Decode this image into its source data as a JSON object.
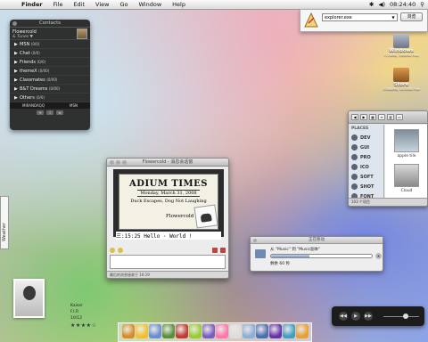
{
  "menubar": {
    "app": "Finder",
    "menus": [
      "File",
      "Edit",
      "View",
      "Go",
      "Window",
      "Help"
    ],
    "clock": "08:24:40"
  },
  "contacts": {
    "title": "Contacts",
    "me_nick": "Flowercold",
    "me_status": "& Tunes ▼",
    "groups": [
      {
        "name": "MSN",
        "count": "(0/0)"
      },
      {
        "name": "Chat",
        "count": "(0/0)"
      },
      {
        "name": "Friends",
        "count": "(0/0)"
      },
      {
        "name": "themeX",
        "count": "(0/00)"
      },
      {
        "name": "Classmates",
        "count": "(0/00)"
      },
      {
        "name": "B&T Dreams",
        "count": "(0/00)"
      },
      {
        "name": "Others",
        "count": "(0/0)"
      }
    ],
    "account_left": "MIRANDAQQ",
    "account_right": "MSN"
  },
  "weather": {
    "label": "Weather"
  },
  "run_dialog": {
    "input": "explorer.exe",
    "button": "浏览"
  },
  "drives": [
    {
      "name": "Windows",
      "info": "7178MB, 1968MB Free",
      "color": "#8e95a8"
    },
    {
      "name": "Store",
      "info": "47866MB, 4044MB Free",
      "color": "#b27a3c"
    }
  ],
  "finder": {
    "places_header": "PLACES",
    "places": [
      "DEV",
      "GUI",
      "PRO",
      "ICO",
      "SOFT",
      "SHOT",
      "FONT"
    ],
    "thumb1": "apple tile",
    "thumb2": "Cloud",
    "status": "103 个项目"
  },
  "chat": {
    "title": "Flowercold - 消息会话窗",
    "masthead": "ADIUM TIMES",
    "date": "Monday, March 31, 2008",
    "headline": "Duck Escapes, Dog Not Laughing",
    "sender": "Flowercold",
    "message": "三:15:25  Hello · World !",
    "statusbar": "最后的消息接收于 16:19"
  },
  "download": {
    "title": "正在移动",
    "line1": "从 \"Music\" 到 \"Music副本\"",
    "progress": 0.38,
    "remaining": "剩余 60 秒"
  },
  "user_card": {
    "line1": "Kaiser",
    "line2": "F.I.R",
    "line3": "10/12",
    "stars": "★★★★☆"
  },
  "itunes": {
    "prev": "◀◀",
    "play": "▶",
    "next": "▶▶"
  },
  "dock": {
    "icon_colors": [
      "#d98a2a",
      "#f0c030",
      "#6c8cd6",
      "#5a8f3c",
      "#c23a3a",
      "#99cc33",
      "#7a5cc2",
      "#ff77aa",
      "#dddddd",
      "#8ab0d8",
      "#4a6fb3",
      "#6633aa",
      "#3fa0c0",
      "#e8a030"
    ]
  }
}
